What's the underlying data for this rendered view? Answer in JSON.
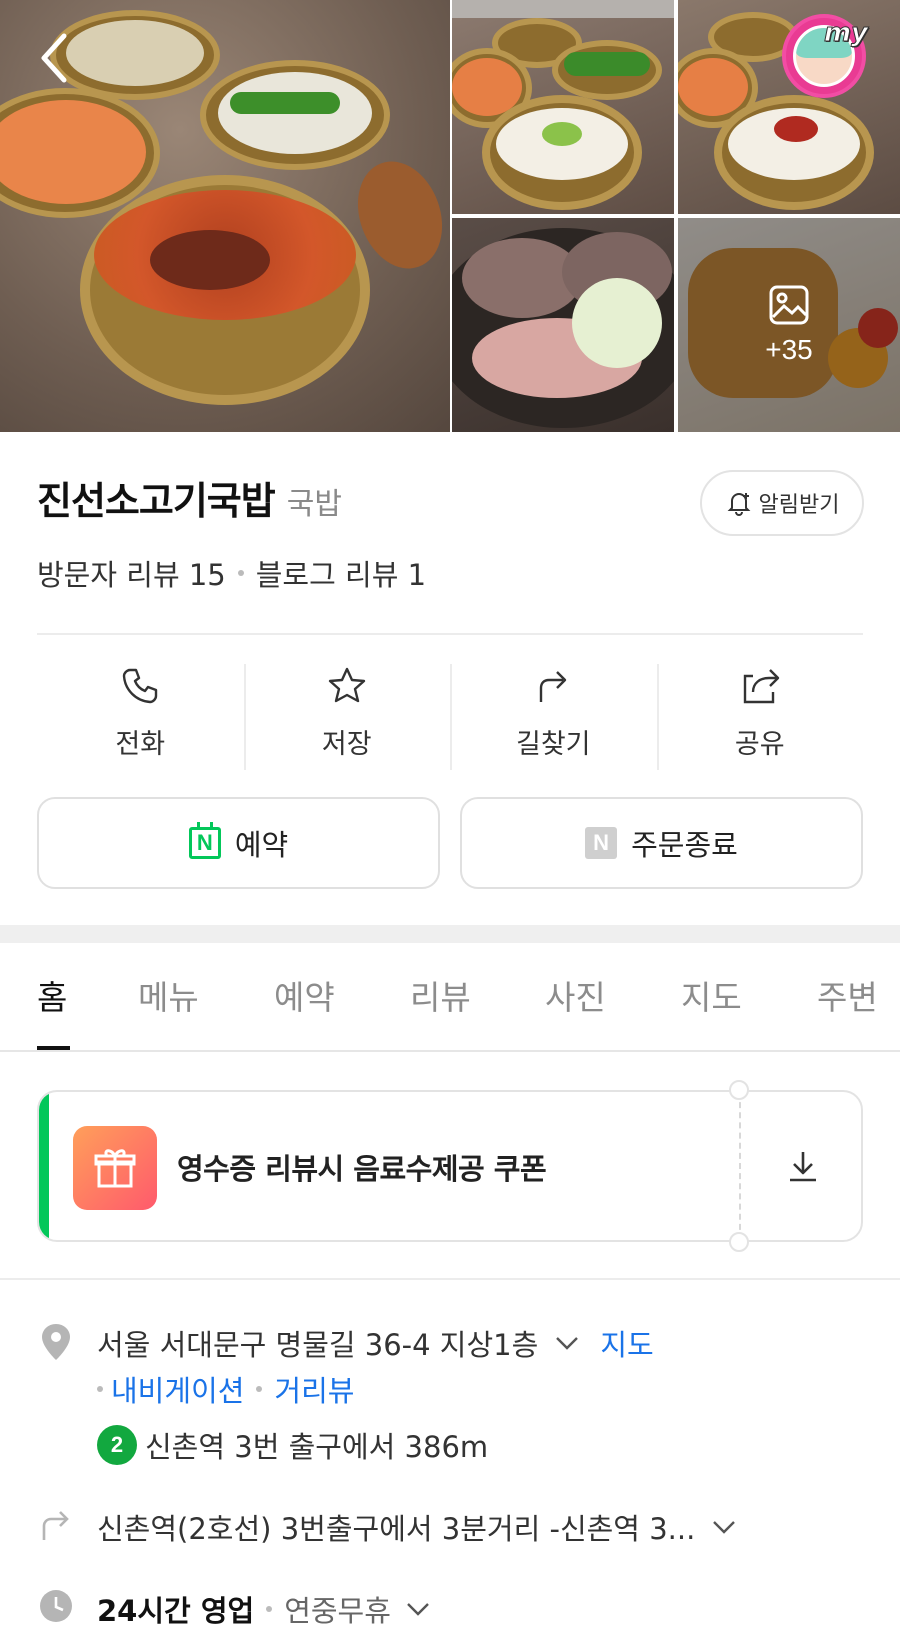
{
  "gallery": {
    "more_count": "+35"
  },
  "avatar": {
    "label": "my"
  },
  "header": {
    "name": "진선소고기국밥",
    "category": "국밥",
    "alert_label": "알림받기",
    "visitor_review": "방문자 리뷰 15",
    "blog_review": "블로그 리뷰 1"
  },
  "actions": {
    "call": "전화",
    "save": "저장",
    "directions": "길찾기",
    "share": "공유"
  },
  "buttons": {
    "reserve": "예약",
    "order": "주문종료",
    "n_badge": "N"
  },
  "tabs": [
    "홈",
    "메뉴",
    "예약",
    "리뷰",
    "사진",
    "지도",
    "주변"
  ],
  "coupon": {
    "text": "영수증 리뷰시 음료수제공 쿠폰"
  },
  "info": {
    "address": "서울 서대문구 명물길 36-4 지상1층",
    "map_link": "지도",
    "navi_link": "내비게이션",
    "streetview_link": "거리뷰",
    "subway_line": "2",
    "subway_text": "신촌역 3번 출구에서 386m",
    "directions_text": "신촌역(2호선) 3번출구에서 3분거리 -신촌역 3...",
    "hours_main": "24시간 영업",
    "hours_sub": "연중무휴"
  },
  "colors": {
    "accent_green": "#03c75a",
    "link_blue": "#1a73e8",
    "subway_green": "#12a83f"
  }
}
